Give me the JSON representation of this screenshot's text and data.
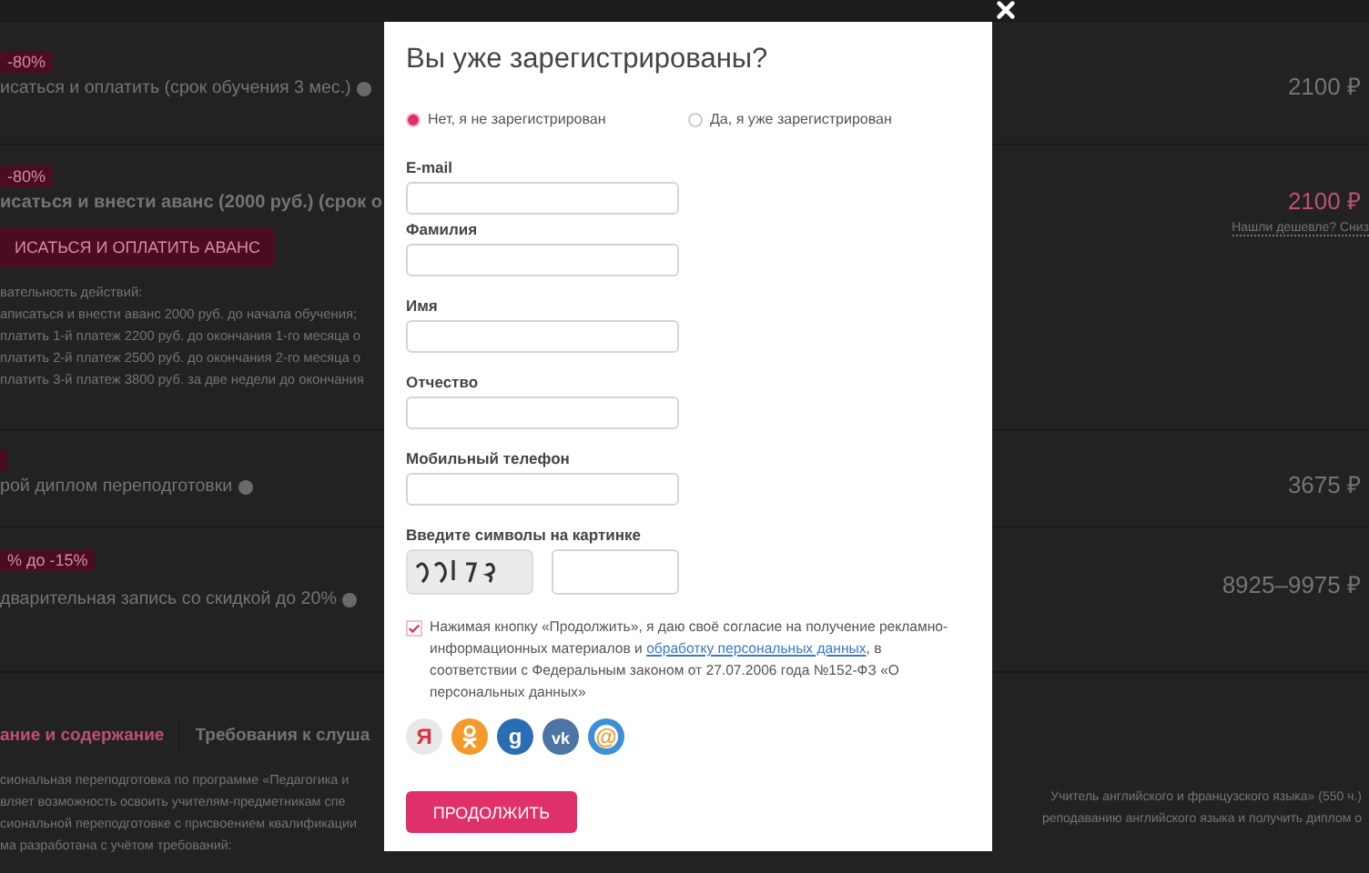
{
  "background": {
    "rows": [
      {
        "kind": "offer",
        "badges": [
          "-80%"
        ],
        "text": "исаться и оплатить (срок обучения 3 мес.)",
        "bold": false,
        "help": true,
        "price": "2100 ₽",
        "price_red": false
      },
      {
        "kind": "offer",
        "badges": [
          "-80%"
        ],
        "text": "исаться и внести аванс (2000 руб.) (срок о",
        "bold": true,
        "help": false,
        "price": "2100 ₽",
        "price_red": true,
        "price_note": "Нашли дешевле? Сниз",
        "button": "ИСАТЬСЯ И ОПЛАТИТЬ АВАНС",
        "steps": [
          "вательность действий:",
          "аписаться и внести аванс 2000 руб. до начала обучения;",
          "платить 1-й платеж 2200 руб. до окончания 1-го месяца о",
          "платить 2-й платеж 2500 руб. до окончания 2-го месяца о",
          "платить 3-й платеж 3800 руб. за две недели до окончания"
        ]
      },
      {
        "kind": "offer",
        "badges": [],
        "text": "рой диплом переподготовки",
        "bold": false,
        "help": true,
        "price": "3675 ₽",
        "price_red": false
      },
      {
        "kind": "offer",
        "badges": [
          "% до -15%"
        ],
        "text": "дварительная запись со скидкой до 20%",
        "bold": false,
        "help": true,
        "price": "8925–9975 ₽",
        "price_red": false
      }
    ],
    "tabs": [
      {
        "label": "ание и содержание",
        "selected": true
      },
      {
        "label": "Требования к слуша",
        "selected": false
      }
    ],
    "paragraph_left": [
      "сиональная переподготовка по программе «Педагогика и",
      "вляет возможность освоить учителям-предметникам спе",
      "сиональной переподготовке с присвоением квалификации",
      "ма разработана с учётом требований:"
    ],
    "paragraph_right": [
      "Учитель английского и французского языка» (550 ч.)",
      "реподаванию английского языка и получить диплом о"
    ]
  },
  "modal": {
    "title": "Вы уже зарегистрированы?",
    "options": [
      {
        "label": "Нет, я не зарегистрирован",
        "selected": true
      },
      {
        "label": "Да, я уже зарегистрирован",
        "selected": false
      }
    ],
    "fields": [
      {
        "label": "E-mail"
      },
      {
        "label": "Фамилия"
      },
      {
        "label": "Имя"
      },
      {
        "label": "Отчество"
      },
      {
        "label": "Мобильный телефон"
      }
    ],
    "captcha_label": "Введите символы на картинке",
    "consent": {
      "checked": true,
      "before": "Нажимая кнопку «Продолжить», я даю своё согласие на получение рекламно-информационных материалов и ",
      "link": "обработку персональных данных",
      "after": ", в соответствии с Федеральным законом от 27.07.2006 года №152-ФЗ «О персональных данных»"
    },
    "socials": [
      {
        "kind": "yandex",
        "glyph": "Я"
      },
      {
        "kind": "ok"
      },
      {
        "kind": "google",
        "glyph": "g"
      },
      {
        "kind": "vk",
        "glyph": "vk"
      },
      {
        "kind": "mail",
        "glyph": "@"
      }
    ],
    "submit": "ПРОДОЛЖИТЬ"
  }
}
